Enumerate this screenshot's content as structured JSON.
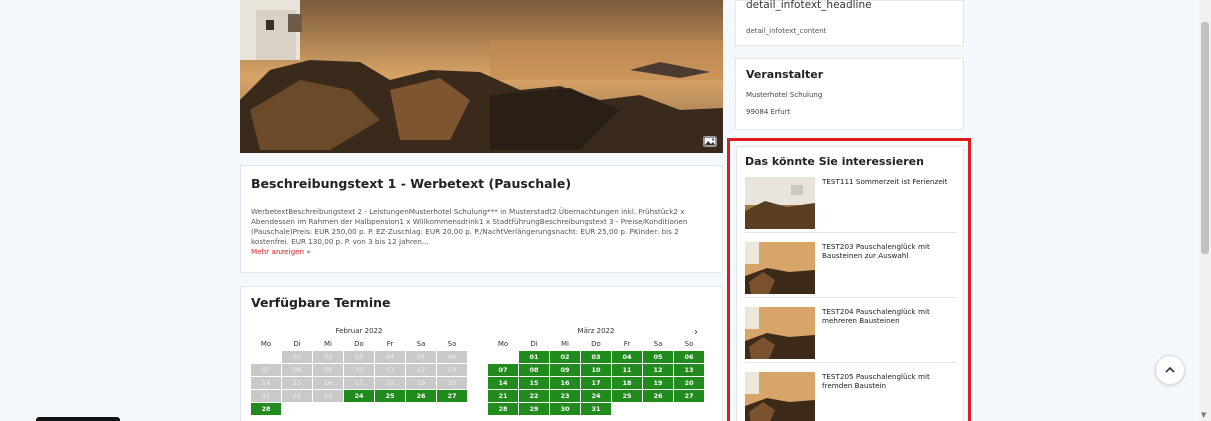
{
  "description": {
    "title": "Beschreibungstext 1 - Werbetext (Pauschale)",
    "body": "WerbetextBeschreibungstext 2 - LeistungenMusterhotel Schulung*** in Musterstadt2 Übernachtungen inkl. Frühstück2 x Abendessen im Rahmen der Halbpension1 x Willkommensdrink1 x StadtführungBeschreibungstext 3 - Preise/Konditionen (Pauschale)Preis: EUR 250,00 p. P. EZ-Zuschlag: EUR 20,00 p. P./NachtVerlängerungsnacht: EUR 25,00 p. PKinder: bis 2 kostenfrei. EUR 130,00 p. P. von 3 bis 12 Jahren...",
    "more_label": "Mehr anzeigen »"
  },
  "termine": {
    "title": "Verfügbare Termine",
    "weekdays": [
      "Mo",
      "Di",
      "Mi",
      "Do",
      "Fr",
      "Sa",
      "So"
    ],
    "next_label": "›",
    "months": [
      {
        "name": "Februar 2022",
        "leading_blanks": 1,
        "days": [
          {
            "d": "01",
            "s": "g"
          },
          {
            "d": "02",
            "s": "g"
          },
          {
            "d": "03",
            "s": "g"
          },
          {
            "d": "04",
            "s": "g"
          },
          {
            "d": "05",
            "s": "g"
          },
          {
            "d": "06",
            "s": "g"
          },
          {
            "d": "07",
            "s": "g"
          },
          {
            "d": "08",
            "s": "g"
          },
          {
            "d": "09",
            "s": "g"
          },
          {
            "d": "10",
            "s": "g"
          },
          {
            "d": "11",
            "s": "g"
          },
          {
            "d": "12",
            "s": "g"
          },
          {
            "d": "13",
            "s": "g"
          },
          {
            "d": "14",
            "s": "g"
          },
          {
            "d": "15",
            "s": "g"
          },
          {
            "d": "16",
            "s": "g"
          },
          {
            "d": "17",
            "s": "g"
          },
          {
            "d": "18",
            "s": "g"
          },
          {
            "d": "19",
            "s": "g"
          },
          {
            "d": "20",
            "s": "g"
          },
          {
            "d": "21",
            "s": "g"
          },
          {
            "d": "22",
            "s": "g"
          },
          {
            "d": "23",
            "s": "g"
          },
          {
            "d": "24",
            "s": "a"
          },
          {
            "d": "25",
            "s": "a"
          },
          {
            "d": "26",
            "s": "a"
          },
          {
            "d": "27",
            "s": "a"
          },
          {
            "d": "28",
            "s": "a"
          }
        ]
      },
      {
        "name": "März 2022",
        "leading_blanks": 1,
        "days": [
          {
            "d": "01",
            "s": "a"
          },
          {
            "d": "02",
            "s": "a"
          },
          {
            "d": "03",
            "s": "a"
          },
          {
            "d": "04",
            "s": "a"
          },
          {
            "d": "05",
            "s": "a"
          },
          {
            "d": "06",
            "s": "a"
          },
          {
            "d": "07",
            "s": "a"
          },
          {
            "d": "08",
            "s": "a"
          },
          {
            "d": "09",
            "s": "a"
          },
          {
            "d": "10",
            "s": "a"
          },
          {
            "d": "11",
            "s": "a"
          },
          {
            "d": "12",
            "s": "a"
          },
          {
            "d": "13",
            "s": "a"
          },
          {
            "d": "14",
            "s": "a"
          },
          {
            "d": "15",
            "s": "a"
          },
          {
            "d": "16",
            "s": "a"
          },
          {
            "d": "17",
            "s": "a"
          },
          {
            "d": "18",
            "s": "a"
          },
          {
            "d": "19",
            "s": "a"
          },
          {
            "d": "20",
            "s": "a"
          },
          {
            "d": "21",
            "s": "a"
          },
          {
            "d": "22",
            "s": "a"
          },
          {
            "d": "23",
            "s": "a"
          },
          {
            "d": "24",
            "s": "a"
          },
          {
            "d": "25",
            "s": "a"
          },
          {
            "d": "26",
            "s": "a"
          },
          {
            "d": "27",
            "s": "a"
          },
          {
            "d": "28",
            "s": "a"
          },
          {
            "d": "29",
            "s": "a"
          },
          {
            "d": "30",
            "s": "a"
          },
          {
            "d": "31",
            "s": "a"
          }
        ]
      }
    ]
  },
  "info": {
    "headline": "detail_infotext_headline",
    "content": "detail_infotext_content"
  },
  "veranstalter": {
    "title": "Veranstalter",
    "name": "Musterhotel Schulung",
    "city": "99084 Erfurt"
  },
  "interessieren": {
    "title": "Das könnte Sie interessieren",
    "items": [
      {
        "title": "TEST111 Sommerzeit ist Ferienzeit"
      },
      {
        "title": "TEST203 Pauschalenglück mit Bausteinen zur Auswahl"
      },
      {
        "title": "TEST204 Pauschalenglück mit mehreren Bausteinen"
      },
      {
        "title": "TEST205 Pauschalenglück mit fremden Baustein"
      }
    ]
  },
  "colors": {
    "available": "#218b1d",
    "unavailable": "#c9c9c9",
    "highlight_box": "#e01b1b",
    "link": "#d9232d"
  },
  "icons": {
    "hero": "image-icon",
    "scroll_top": "chevron-up-icon"
  }
}
